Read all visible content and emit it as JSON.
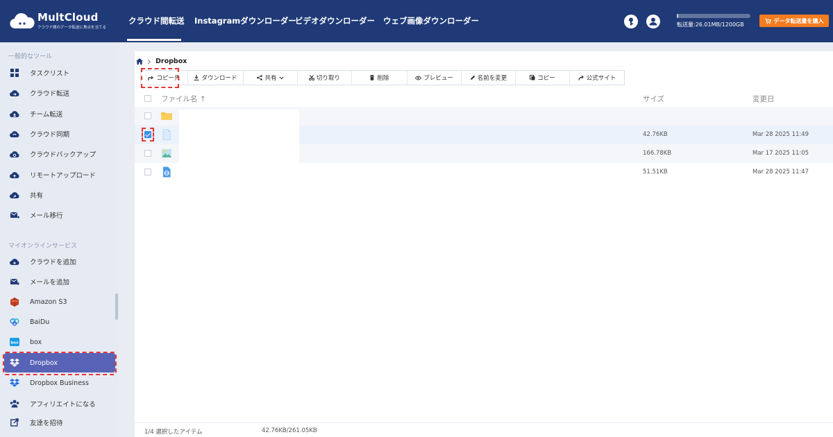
{
  "app": {
    "name": "MultCloud",
    "tagline": "クラウド間のデータ転送に焦点を当てる"
  },
  "nav": {
    "tabs": [
      "クラウド間転送",
      "Instagramダウンローダー",
      "ビデオダウンローダー",
      "ウェブ画像ダウンローダー"
    ],
    "active_index": 0
  },
  "header": {
    "quota_label": "転送量:26.01MB/1200GB",
    "quota_fraction": 0.02,
    "buy_button": "データ転送量を購入"
  },
  "sidebar": {
    "tools_title": "一般的なツール",
    "tools": [
      {
        "label": "タスクリスト",
        "icon": "tasklist-icon"
      },
      {
        "label": "クラウド転送",
        "icon": "cloud-transfer-icon"
      },
      {
        "label": "チーム転送",
        "icon": "team-transfer-icon"
      },
      {
        "label": "クラウド同期",
        "icon": "cloud-sync-icon"
      },
      {
        "label": "クラウドバックアップ",
        "icon": "cloud-backup-icon"
      },
      {
        "label": "リモートアップロード",
        "icon": "remote-upload-icon"
      },
      {
        "label": "共有",
        "icon": "share-cloud-icon"
      },
      {
        "label": "メール移行",
        "icon": "email-migration-icon"
      }
    ],
    "services_title": "マイオンラインサービス",
    "services": [
      {
        "label": "クラウドを追加",
        "icon": "add-cloud-icon"
      },
      {
        "label": "メールを追加",
        "icon": "add-mail-icon"
      },
      {
        "label": "Amazon S3",
        "icon": "amazon-s3-icon"
      },
      {
        "label": "BaiDu",
        "icon": "baidu-icon"
      },
      {
        "label": "box",
        "icon": "box-icon"
      },
      {
        "label": "Dropbox",
        "icon": "dropbox-icon",
        "active": true
      },
      {
        "label": "Dropbox Business",
        "icon": "dropbox-business-icon"
      },
      {
        "label": "アフィリエイトになる",
        "icon": "affiliate-icon"
      },
      {
        "label": "友達を招待",
        "icon": "invite-icon"
      }
    ]
  },
  "breadcrumb": {
    "current": "Dropbox"
  },
  "toolbar": {
    "copy_to": "コピー先",
    "download": "ダウンロード",
    "share": "共有",
    "cut": "切り取り",
    "delete": "削除",
    "preview": "プレビュー",
    "rename": "名前を変更",
    "copy": "コピー",
    "official_site": "公式サイト"
  },
  "file_list": {
    "columns": {
      "name": "ファイル名",
      "size": "サイズ",
      "modified": "変更日"
    },
    "rows": [
      {
        "type": "folder",
        "size": "",
        "modified": "",
        "checked": false
      },
      {
        "type": "document",
        "size": "42.76KB",
        "modified": "Mar 28 2025 11:49",
        "checked": true
      },
      {
        "type": "image",
        "size": "166.78KB",
        "modified": "Mar 17 2025 11:05",
        "checked": false
      },
      {
        "type": "web-file",
        "size": "51.51KB",
        "modified": "Mar 28 2025 11:47",
        "checked": false
      }
    ]
  },
  "footer": {
    "selected": "1/4 選択したアイテム",
    "size": "42.76KB/261.05KB"
  },
  "colors": {
    "header_bg": "#1f3a76",
    "active_item": "#5863b7",
    "buy_button": "#f47c20",
    "highlight_outline": "#e53535"
  }
}
